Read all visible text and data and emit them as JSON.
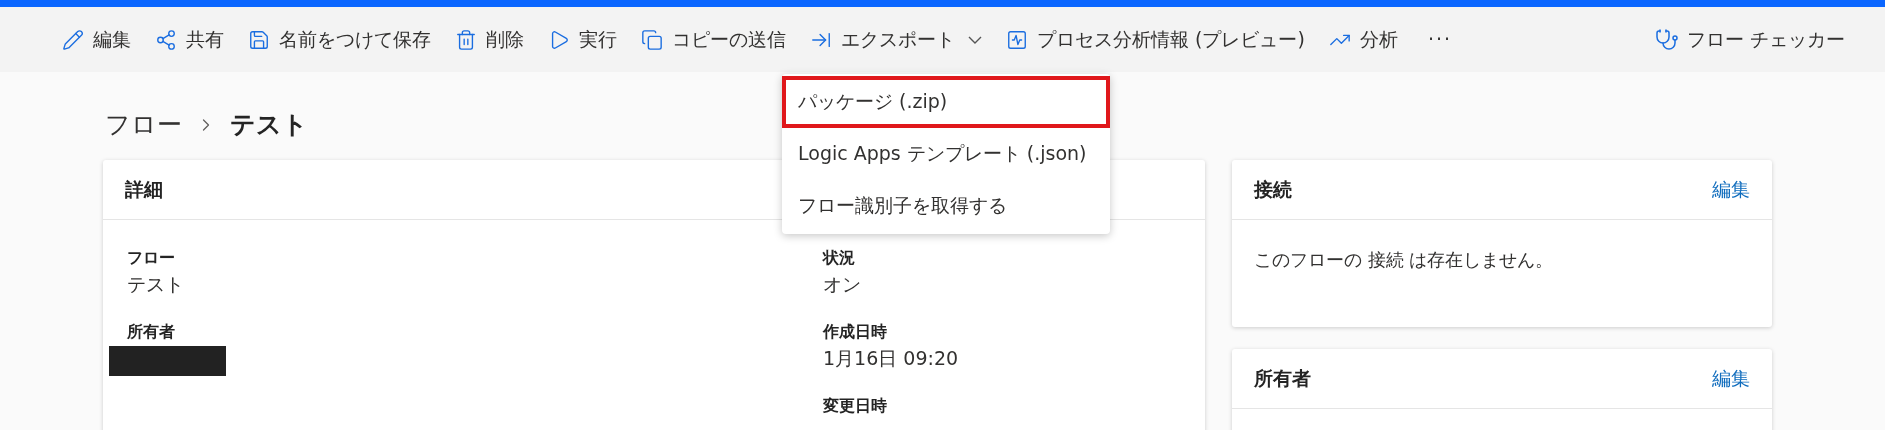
{
  "toolbar": {
    "items": [
      {
        "label": "編集",
        "kind": "action"
      },
      {
        "label": "共有",
        "kind": "action"
      },
      {
        "label": "名前をつけて保存",
        "kind": "action"
      },
      {
        "label": "削除",
        "kind": "action"
      },
      {
        "label": "実行",
        "kind": "action"
      },
      {
        "label": "コピーの送信",
        "kind": "action"
      },
      {
        "label": "エクスポート",
        "kind": "menu",
        "expanded": true
      },
      {
        "label": "プロセス分析情報 (プレビュー)",
        "kind": "action"
      },
      {
        "label": "分析",
        "kind": "action"
      },
      {
        "label": "···",
        "kind": "more"
      }
    ],
    "right_item": {
      "label": "フロー チェッカー"
    }
  },
  "export_menu": {
    "items": [
      {
        "label": "パッケージ (.zip)",
        "highlighted": true
      },
      {
        "label": "Logic Apps テンプレート (.json)",
        "highlighted": false
      },
      {
        "label": "フロー識別子を取得する",
        "highlighted": false
      }
    ]
  },
  "breadcrumb": {
    "parent": "フロー",
    "current": "テスト"
  },
  "details_card": {
    "title": "詳細",
    "left_fields": [
      {
        "label": "フロー",
        "value": "テスト",
        "kind": "text"
      },
      {
        "label": "所有者",
        "kind": "redacted"
      }
    ],
    "right_fields": [
      {
        "label": "状況",
        "value": "オン",
        "kind": "text"
      },
      {
        "label": "作成日時",
        "value": "1月16日 09:20",
        "kind": "text"
      },
      {
        "label": "変更日時",
        "kind": "label"
      }
    ]
  },
  "connections_card": {
    "title": "接続",
    "edit_link": "編集",
    "message": "このフローの 接続 は存在しません。"
  },
  "owners_card": {
    "title": "所有者",
    "edit_link": "編集"
  }
}
